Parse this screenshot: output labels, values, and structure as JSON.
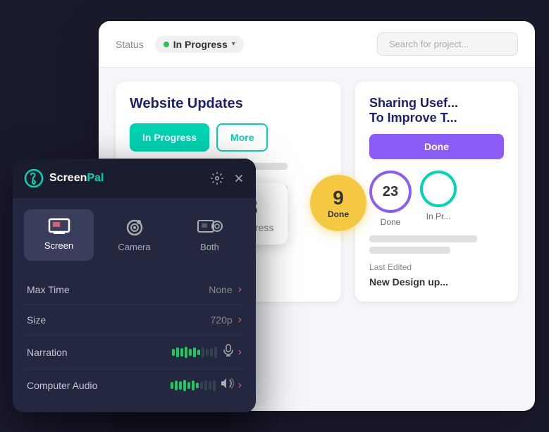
{
  "background": {
    "color": "#1a1a2e"
  },
  "project_card": {
    "header": {
      "status_label": "Status",
      "status_value": "In Progress",
      "search_placeholder": "Search for project..."
    },
    "website_updates": {
      "title": "Website Updates",
      "btn_in_progress": "In Progress",
      "btn_more": "More"
    },
    "sharing_card": {
      "title": "Sharing Usef... To Improve T...",
      "btn_done": "Done",
      "stats": [
        {
          "number": "23",
          "label": "Done",
          "type": "purple"
        },
        {
          "number": "",
          "label": "In Pr...",
          "type": "teal"
        }
      ]
    },
    "last_edited": {
      "label": "Last Edited",
      "value": "New Design up..."
    }
  },
  "stat_18": {
    "number": "18",
    "label": "...rogress"
  },
  "done_badge": {
    "number": "9",
    "label": "Done"
  },
  "screenpal": {
    "logo_text_screen": "Screen",
    "logo_text_pal": "Pal",
    "modes": [
      {
        "id": "screen",
        "label": "Screen",
        "active": true
      },
      {
        "id": "camera",
        "label": "Camera",
        "active": false
      },
      {
        "id": "both",
        "label": "Both",
        "active": false
      }
    ],
    "settings": [
      {
        "id": "max-time",
        "label": "Max Time",
        "value": "None"
      },
      {
        "id": "size",
        "label": "Size",
        "value": "720p"
      },
      {
        "id": "narration",
        "label": "Narration",
        "value": "",
        "has_meter": true
      },
      {
        "id": "computer-audio",
        "label": "Computer Audio",
        "value": "",
        "has_meter": true
      }
    ]
  }
}
